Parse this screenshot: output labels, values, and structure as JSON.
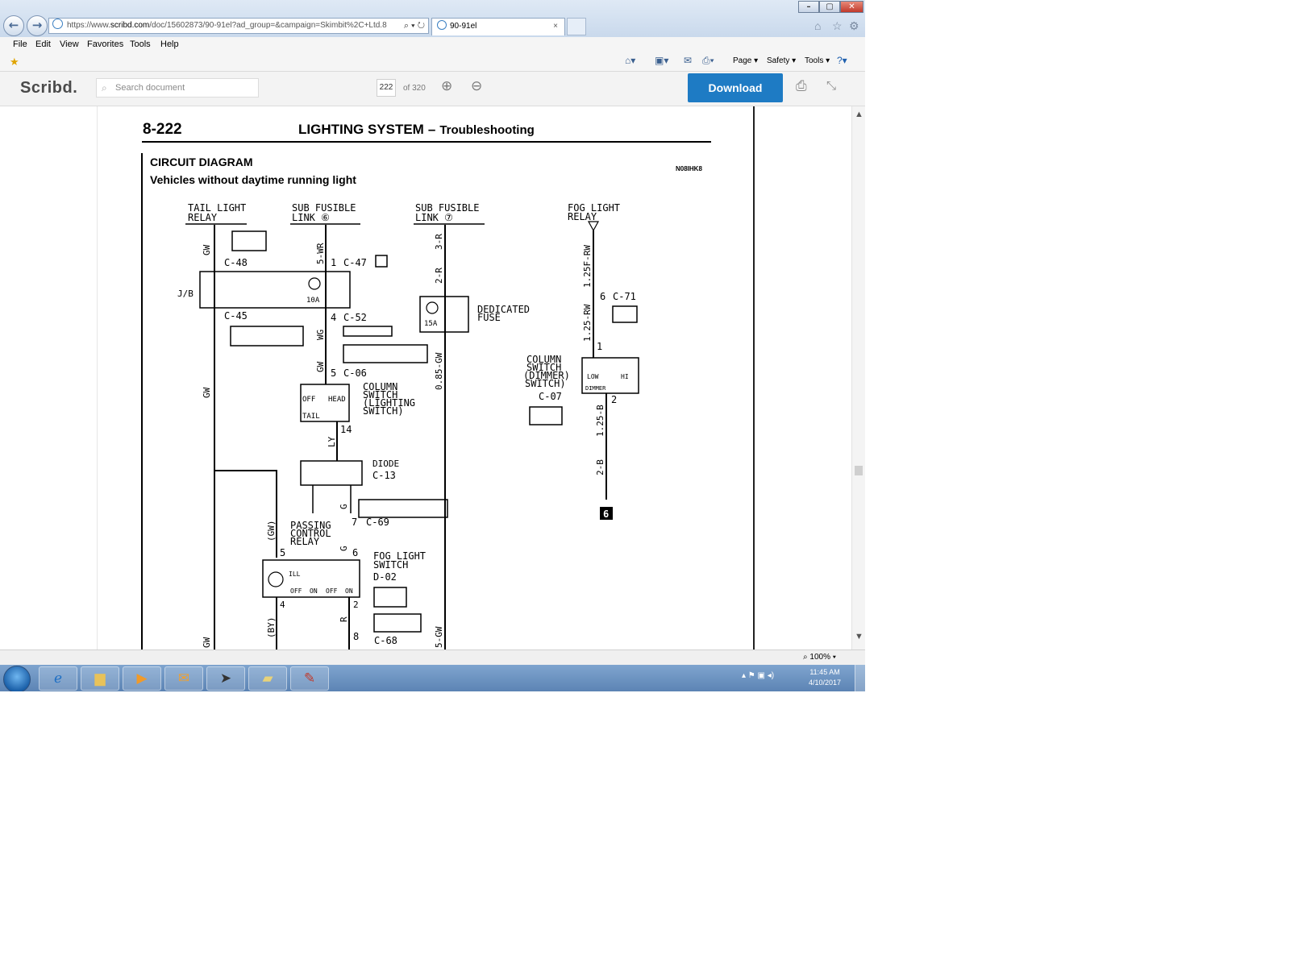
{
  "browser": {
    "url_prefix": "https://www.",
    "url_host": "scribd.com",
    "url_rest": "/doc/15602873/90-91el?ad_group=&campaign=Skimbit%2C+Ltd.8",
    "tab_title": "90-91el",
    "menu": [
      "File",
      "Edit",
      "View",
      "Favorites",
      "Tools",
      "Help"
    ],
    "commands": [
      "Page",
      "Safety",
      "Tools"
    ]
  },
  "scribd": {
    "logo": "Scribd.",
    "search_placeholder": "Search document",
    "current_page": "222",
    "page_count": "of 320",
    "download_label": "Download"
  },
  "document": {
    "page_number": "8-222",
    "header_title": "LIGHTING SYSTEM",
    "header_dash": "–",
    "header_subtitle": "Troubleshooting",
    "section_title": "CIRCUIT DIAGRAM",
    "section_subtitle": "Vehicles without daytime running light",
    "ref_code": "N08IHK8",
    "labels": {
      "tail_light": "TAIL LIGHT",
      "relay": "RELAY",
      "sub_fusible_link_1": "SUB FUSIBLE",
      "link_6": "LINK ⑥",
      "sub_fusible_link_2": "SUB FUSIBLE",
      "link_7": "LINK ⑦",
      "fog_light": "FOG LIGHT",
      "fog_relay": "RELAY",
      "c48": "C-48",
      "c47": "C-47",
      "c45": "C-45",
      "c52": "C-52",
      "c06": "C-06",
      "c71": "C-71",
      "c07": "C-07",
      "c13": "C-13",
      "c69": "C-69",
      "d02": "D-02",
      "c68": "C-68",
      "jb": "J/B",
      "fuse10": "10A",
      "fuse15": "15A",
      "dedicated": "DEDICATED",
      "fuse_word": "FUSE",
      "column_switch_l1": "COLUMN",
      "column_switch_l2": "SWITCH",
      "column_switch_l3": "(LIGHTING",
      "column_switch_l4": "SWITCH)",
      "dimmer_l1": "COLUMN",
      "dimmer_l2": "SWITCH",
      "dimmer_l3": "(DIMMER)",
      "dimmer_l4": "SWITCH)",
      "diode": "DIODE",
      "passing_l1": "PASSING",
      "passing_l2": "CONTROL",
      "passing_l3": "RELAY",
      "fog_switch_l1": "FOG LIGHT",
      "fog_switch_l2": "SWITCH",
      "off": "OFF",
      "head": "HEAD",
      "tail": "TAIL",
      "low": "LOW",
      "hi": "HI",
      "dimmer": "DIMMER",
      "ill": "ILL",
      "on": "ON",
      "ground": "6",
      "w_5wr": "5-WR",
      "w_wg": "WG",
      "w_gw1": "GW",
      "w_gw2": "GW",
      "w_gw3": "GW",
      "w_ly": "LY",
      "w_3r": "3-R",
      "w_2r": "2-R",
      "w_085gw": "0.85-GW",
      "w_125frw": "1.25F-RW",
      "w_125rw": "1.25-RW",
      "w_125b": "1.25-B",
      "w_2b": "2-B",
      "w_g1": "G",
      "w_g2": "G",
      "w_gw_p": "(GW)",
      "w_by": "(BY)",
      "w_r": "R",
      "w_5gw": "5-GW",
      "pin_1": "1",
      "pin_4": "4",
      "pin_5": "5",
      "pin_14": "14",
      "pin_6": "6",
      "pin_6b": "6",
      "pin_1b": "1",
      "pin_2": "2",
      "pin_7": "7",
      "pin_5b": "5",
      "pin_4b": "4",
      "pin_2b": "2",
      "pin_8": "8"
    }
  },
  "status": {
    "zoom": "100%"
  },
  "taskbar": {
    "time": "11:45 AM",
    "date": "4/10/2017"
  },
  "colors": {
    "download_bg": "#1e7bc4",
    "taskbar": "#6a92c2"
  }
}
